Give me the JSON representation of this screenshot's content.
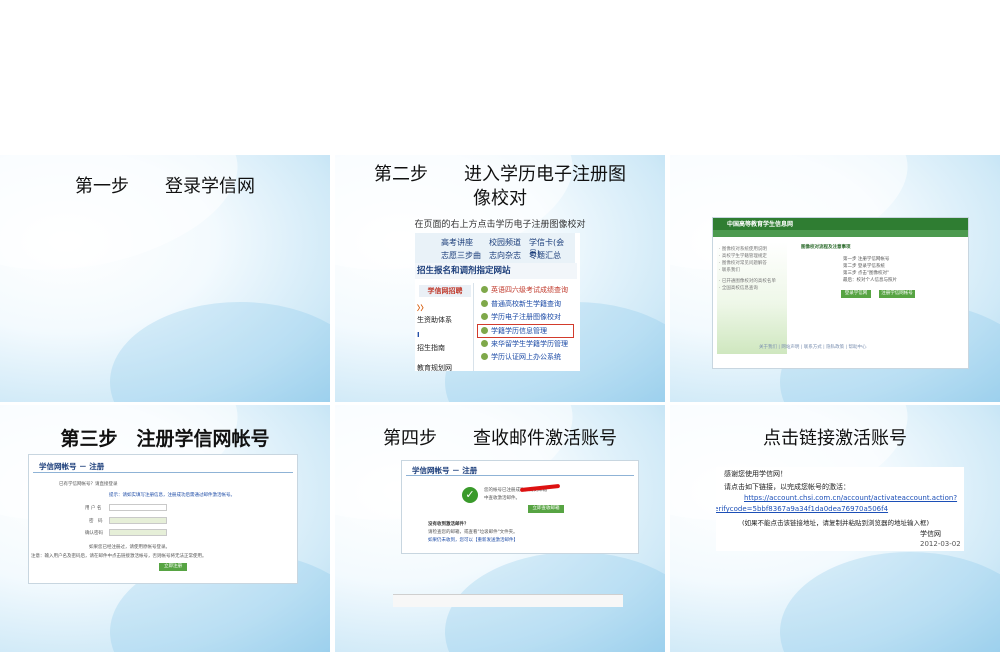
{
  "slides": [
    {
      "title": "第一步　　登录学信网"
    },
    {
      "title": "第二步　　进入学历电子注册图像校对",
      "caption": "在页面的右上方点击学历电子注册图像校对",
      "menu": {
        "top_links": [
          "高考讲座",
          "校园频道",
          "学信卡(会员)",
          "志愿三步曲",
          "志向杂志",
          "专题汇总"
        ],
        "section_title": "招生报名和调剂指定网站",
        "left_tab": "学信网招聘",
        "left_items": [
          "〉〉",
          "生资助体系",
          "I",
          "招生指南",
          "教育规划网"
        ],
        "links": [
          "英语四六级考试成绩查询",
          "普通高校新生学籍查询",
          "学历电子注册图像校对",
          "学籍学历信息管理",
          "来华留学生学籍学历管理",
          "学历认证网上办公系统"
        ]
      }
    },
    {
      "title": "",
      "site": {
        "header": "中国高等教育学生信息网",
        "nav": [
          "学信档案",
          "学生申请",
          "学历认证",
          "图像校对"
        ],
        "side_items": [
          "· 图像校对系统使用说明",
          "· 高校学生学籍管理规定",
          "· 图像校对常见问题解答",
          "· 联系我们",
          "· 已开通图像校对的高校名单",
          "· 全国高校信息查询"
        ],
        "main_heading": "图像校对流程及注意事项",
        "steps": [
          "第一步 注册学信网帐号",
          "第二步 登录学信系统",
          "第三步 点击\"图像校对\"",
          "最后：校对个人信息与照片"
        ],
        "btn_login": "登录学信网",
        "btn_register": "注册学信网帐号",
        "footer": "关于我们 | 网站声明 | 联系方式 | 隐私政策 | 帮助中心"
      }
    },
    {
      "title": "第三步　注册学信网帐号",
      "reg": {
        "heading": "学信网帐号 － 注册",
        "hint": "已有学信网帐号？请直接登录",
        "tip": "提示：请如实填写注册信息，注册成功后需通过邮件激活帐号。",
        "labels": [
          "用 户 名",
          "密　码",
          "确认密码"
        ],
        "note1": "如果您已经注册过，请使用原帐号登录。",
        "note2": "注意：输入用户名及密码后，请在邮件中点击链接激活帐号，否则帐号将无法正常使用。",
        "button": "立即注册"
      }
    },
    {
      "title": "第四步　　查收邮件激活账号",
      "mail": {
        "heading": "学信网帐号 － 注册",
        "msg1": "您的帐号已注册成功，请到邮箱",
        "msg2": "中查收激活邮件。",
        "button": "立即查收邮箱",
        "tips_title": "没有收到激活邮件？",
        "tips1": "请检查您的邮箱，或查看\"垃圾邮件\"文件夹。",
        "tips2": "如果仍未收到，您可以【重新发送激活邮件】"
      }
    },
    {
      "title": "点击链接激活账号",
      "activation": {
        "greeting": "感谢您使用学信网！",
        "instruction": "请点击如下链接，以完成您帐号的激活：",
        "link_line1": "https://account.chsi.com.cn/account/activateaccount.action?",
        "link_line2": "verifycode=5bbf8367a9a34f1da0dea76970a506f4",
        "note": "(如果不能点击该链接地址，请复制并粘贴到浏览器的地址输入框)",
        "signature": "学信网",
        "date": "2012-03-02"
      }
    }
  ]
}
